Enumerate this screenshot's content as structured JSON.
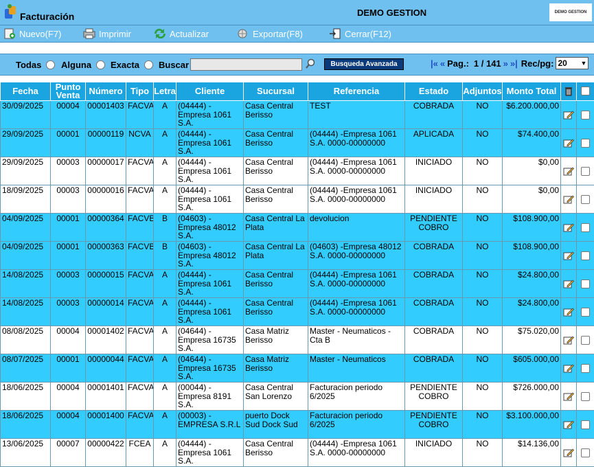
{
  "header": {
    "title": "Facturación",
    "company": "DEMO GESTION",
    "brand": "DEMO GESTION"
  },
  "toolbar": {
    "nuevo": "Nuevo(F7)",
    "imprimir": "Imprimir",
    "actualizar": "Actualizar",
    "exportar": "Exportar(F8)",
    "cerrar": "Cerrar(F12)"
  },
  "search": {
    "todas": "Todas",
    "alguna": "Alguna",
    "exacta": "Exacta",
    "buscar": "Buscar",
    "value": "",
    "advanced": "Busqueda Avanzada"
  },
  "pager": {
    "label": "Pag.:",
    "current": "1 / 141",
    "rec_label": "Rec/pg:",
    "rec_value": "20"
  },
  "table": {
    "headers": [
      "Fecha",
      "Punto Venta",
      "Número",
      "Tipo",
      "Letra",
      "Cliente",
      "Sucursal",
      "Referencia",
      "Estado",
      "Adjuntos",
      "Monto Total"
    ],
    "rows": [
      {
        "fecha": "30/09/2025",
        "pv": "00004",
        "num": "00001403",
        "tipo": "FACVA",
        "letra": "A",
        "cliente": "(04444) - Empresa 1061 S.A.",
        "sucursal": "Casa Central Berisso",
        "ref": "TEST",
        "estado": "COBRADA",
        "adj": "NO",
        "monto": "$6.200.000,00"
      },
      {
        "fecha": "29/09/2025",
        "pv": "00001",
        "num": "00000119",
        "tipo": "NCVA",
        "letra": "A",
        "cliente": "(04444) - Empresa 1061 S.A.",
        "sucursal": "Casa Central Berisso",
        "ref": "(04444) -Empresa 1061 S.A. 0000-00000000",
        "estado": "APLICADA",
        "adj": "NO",
        "monto": "$74.400,00"
      },
      {
        "fecha": "29/09/2025",
        "pv": "00003",
        "num": "00000017",
        "tipo": "FACVA",
        "letra": "A",
        "cliente": "(04444) - Empresa 1061 S.A.",
        "sucursal": "Casa Central Berisso",
        "ref": "(04444) -Empresa 1061 S.A. 0000-00000000",
        "estado": "INICIADO",
        "adj": "NO",
        "monto": "$0,00"
      },
      {
        "fecha": "18/09/2025",
        "pv": "00003",
        "num": "00000016",
        "tipo": "FACVA",
        "letra": "A",
        "cliente": "(04444) - Empresa 1061 S.A.",
        "sucursal": "Casa Central Berisso",
        "ref": "(04444) -Empresa 1061 S.A. 0000-00000000",
        "estado": "INICIADO",
        "adj": "NO",
        "monto": "$0,00"
      },
      {
        "fecha": "04/09/2025",
        "pv": "00001",
        "num": "00000364",
        "tipo": "FACVB",
        "letra": "B",
        "cliente": "(04603) - Empresa 48012 S.A.",
        "sucursal": "Casa Central La Plata",
        "ref": "devolucion",
        "estado": "PENDIENTE COBRO",
        "adj": "NO",
        "monto": "$108.900,00"
      },
      {
        "fecha": "04/09/2025",
        "pv": "00001",
        "num": "00000363",
        "tipo": "FACVB",
        "letra": "B",
        "cliente": "(04603) - Empresa 48012 S.A.",
        "sucursal": "Casa Central La Plata",
        "ref": "(04603) -Empresa 48012 S.A. 0000-00000000",
        "estado": "COBRADA",
        "adj": "NO",
        "monto": "$108.900,00"
      },
      {
        "fecha": "14/08/2025",
        "pv": "00003",
        "num": "00000015",
        "tipo": "FACVA",
        "letra": "A",
        "cliente": "(04444) - Empresa 1061 S.A.",
        "sucursal": "Casa Central Berisso",
        "ref": "(04444) -Empresa 1061 S.A. 0000-00000000",
        "estado": "COBRADA",
        "adj": "NO",
        "monto": "$24.800,00"
      },
      {
        "fecha": "14/08/2025",
        "pv": "00003",
        "num": "00000014",
        "tipo": "FACVA",
        "letra": "A",
        "cliente": "(04444) - Empresa 1061 S.A.",
        "sucursal": "Casa Central Berisso",
        "ref": "(04444) -Empresa 1061 S.A. 0000-00000000",
        "estado": "COBRADA",
        "adj": "NO",
        "monto": "$24.800,00"
      },
      {
        "fecha": "08/08/2025",
        "pv": "00004",
        "num": "00001402",
        "tipo": "FACVA",
        "letra": "A",
        "cliente": "(04644) - Empresa 16735 S.A.",
        "sucursal": "Casa Matriz Berisso",
        "ref": "Master - Neumaticos - Cta B",
        "estado": "COBRADA",
        "adj": "NO",
        "monto": "$75.020,00"
      },
      {
        "fecha": "08/07/2025",
        "pv": "00001",
        "num": "00000044",
        "tipo": "FACVA",
        "letra": "A",
        "cliente": "(04644) - Empresa 16735 S.A.",
        "sucursal": "Casa Matriz Berisso",
        "ref": "Master - Neumaticos",
        "estado": "COBRADA",
        "adj": "NO",
        "monto": "$605.000,00"
      },
      {
        "fecha": "18/06/2025",
        "pv": "00004",
        "num": "00001401",
        "tipo": "FACVA",
        "letra": "A",
        "cliente": "(00044) - Empresa 8191 S.A.",
        "sucursal": "Casa Central San Lorenzo",
        "ref": "Facturacion periodo 6/2025",
        "estado": "PENDIENTE COBRO",
        "adj": "NO",
        "monto": "$726.000,00"
      },
      {
        "fecha": "18/06/2025",
        "pv": "00004",
        "num": "00001400",
        "tipo": "FACVA",
        "letra": "A",
        "cliente": "(00003) - EMPRESA S.R.L",
        "sucursal": "puerto Dock Sud Dock Sud",
        "ref": "Facturacion periodo 6/2025",
        "estado": "PENDIENTE COBRO",
        "adj": "NO",
        "monto": "$3.100.000,00"
      },
      {
        "fecha": "13/06/2025",
        "pv": "00007",
        "num": "00000422",
        "tipo": "FCEA",
        "letra": "A",
        "cliente": "(04444) - Empresa 1061 S.A.",
        "sucursal": "Casa Central Berisso",
        "ref": "(04444) -Empresa 1061 S.A. 0000-00000000",
        "estado": "INICIADO",
        "adj": "NO",
        "monto": "$14.136,00"
      }
    ],
    "row_colors": [
      "b",
      "b",
      "w",
      "w",
      "b",
      "b",
      "b",
      "b",
      "w",
      "b",
      "w",
      "b",
      "w"
    ]
  }
}
